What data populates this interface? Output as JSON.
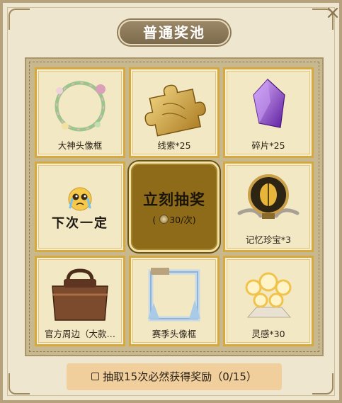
{
  "title": "普通奖池",
  "draw_button": {
    "label": "立刻抽奖",
    "cost_prefix": "(",
    "cost_text": "30/次)"
  },
  "rewards": [
    {
      "label": "大神头像框",
      "icon": "flower-wreath-frame"
    },
    {
      "label": "线索*25",
      "icon": "golden-puzzle-piece"
    },
    {
      "label": "碎片*25",
      "icon": "purple-crystal-shard"
    },
    {
      "label": "下次一定",
      "icon": "crying-emoji"
    },
    {
      "label": "记忆珍宝*3",
      "icon": "golden-orb-treasure"
    },
    {
      "label": "官方周边（大款…",
      "icon": "leather-travel-bag"
    },
    {
      "label": "赛季头像框",
      "icon": "ice-crystal-frame"
    },
    {
      "label": "灵感*30",
      "icon": "glowing-bulbs"
    }
  ],
  "guarantee_text": "抽取15次必然获得奖励（0/15）",
  "colors": {
    "cell_border": "#d6a93f",
    "draw_button": "#8e6b18",
    "banner": "#f1cf9d"
  }
}
